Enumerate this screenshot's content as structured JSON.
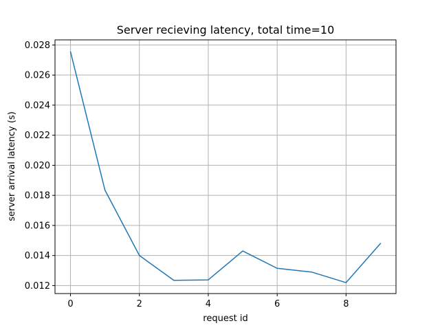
{
  "chart_data": {
    "type": "line",
    "title": "Server recieving latency, total time=10",
    "xlabel": "request id",
    "ylabel": "server arrival latency (s)",
    "xlim": [
      -0.45,
      9.45
    ],
    "ylim": [
      0.01147,
      0.02834
    ],
    "x_ticks": [
      0,
      2,
      4,
      6,
      8
    ],
    "x_tick_labels": [
      "0",
      "2",
      "4",
      "6",
      "8"
    ],
    "y_ticks": [
      0.012,
      0.014,
      0.016,
      0.018,
      0.02,
      0.022,
      0.024,
      0.026,
      0.028
    ],
    "y_tick_labels": [
      "0.012",
      "0.014",
      "0.016",
      "0.018",
      "0.020",
      "0.022",
      "0.024",
      "0.026",
      "0.028"
    ],
    "grid": true,
    "x": [
      0,
      1,
      2,
      3,
      4,
      5,
      6,
      7,
      8,
      9
    ],
    "series": [
      {
        "values": [
          0.02755,
          0.01835,
          0.014,
          0.01235,
          0.01238,
          0.0143,
          0.01315,
          0.0129,
          0.0122,
          0.0148
        ],
        "color": "#1f77b4"
      }
    ]
  }
}
